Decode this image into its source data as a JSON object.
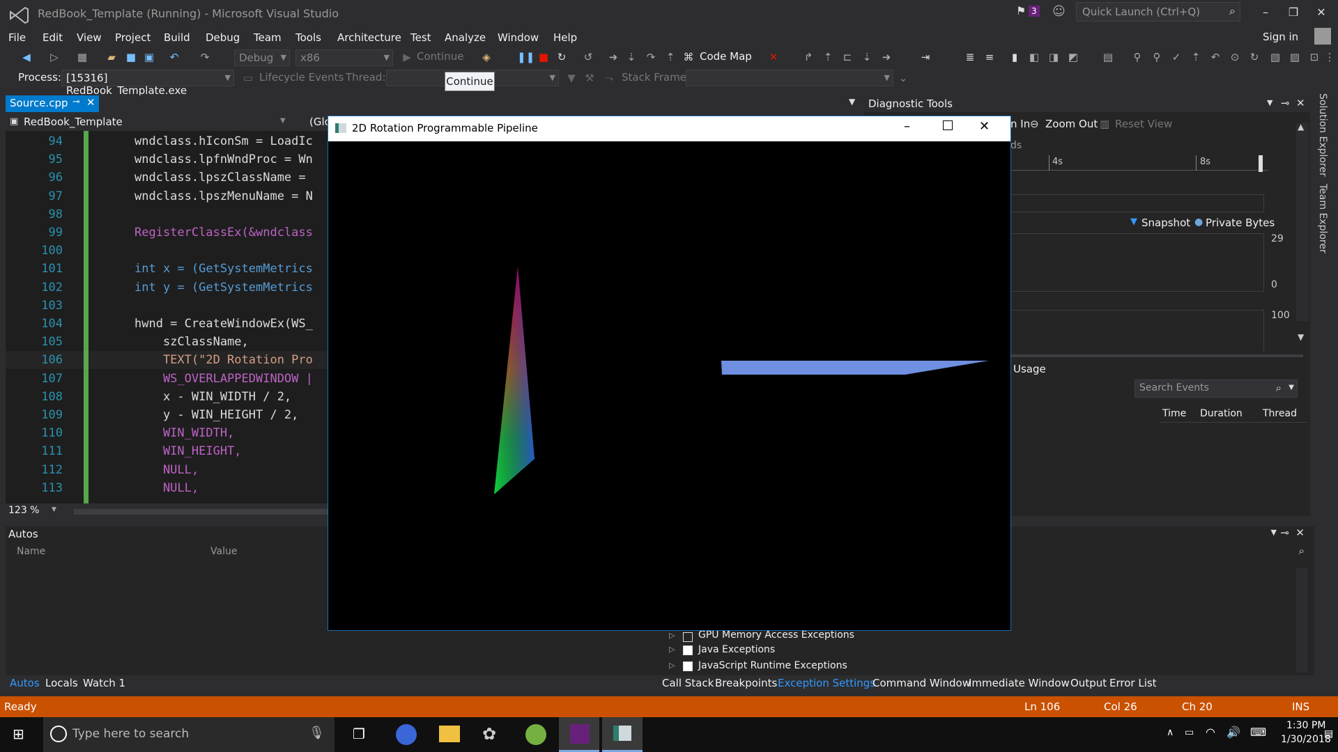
{
  "titlebar": {
    "app_title": "RedBook_Template (Running) - Microsoft Visual Studio",
    "notif_count": "3",
    "quick_launch": "Quick Launch (Ctrl+Q)"
  },
  "menu": [
    "File",
    "Edit",
    "View",
    "Project",
    "Build",
    "Debug",
    "Team",
    "Tools",
    "Architecture",
    "Test",
    "Analyze",
    "Window",
    "Help"
  ],
  "sign_in": "Sign in",
  "toolbar": {
    "config": "Debug",
    "platform": "x86",
    "continue": "Continue",
    "code_map": "Code Map"
  },
  "toolbar2": {
    "process_label": "Process:",
    "process_value": "[15316] RedBook_Template.exe",
    "lifecycle": "Lifecycle Events",
    "thread_label": "Thread:",
    "stack_label": "Stack Frame:"
  },
  "tooltip": "Continue",
  "editor": {
    "tab": "Source.cpp",
    "project": "RedBook_Template",
    "scope": "(Glo",
    "zoom": "123 %",
    "lines": [
      {
        "n": "94",
        "t": "wndclass.hIconSm = LoadIc"
      },
      {
        "n": "95",
        "t": "wndclass.lpfnWndProc = Wn"
      },
      {
        "n": "96",
        "t": "wndclass.lpszClassName = "
      },
      {
        "n": "97",
        "t": "wndclass.lpszMenuName = N"
      },
      {
        "n": "98",
        "t": ""
      },
      {
        "n": "99",
        "t": "RegisterClassEx(&wndclass"
      },
      {
        "n": "100",
        "t": ""
      },
      {
        "n": "101",
        "t": "int x = (GetSystemMetrics"
      },
      {
        "n": "102",
        "t": "int y = (GetSystemMetrics"
      },
      {
        "n": "103",
        "t": ""
      },
      {
        "n": "104",
        "t": "hwnd = CreateWindowEx(WS_"
      },
      {
        "n": "105",
        "t": "    szClassName,"
      },
      {
        "n": "106",
        "t": "    TEXT(\"2D Rotation Pro"
      },
      {
        "n": "107",
        "t": "    WS_OVERLAPPEDWINDOW |"
      },
      {
        "n": "108",
        "t": "    x - WIN_WIDTH / 2,"
      },
      {
        "n": "109",
        "t": "    y - WIN_HEIGHT / 2,"
      },
      {
        "n": "110",
        "t": "    WIN_WIDTH,"
      },
      {
        "n": "111",
        "t": "    WIN_HEIGHT,"
      },
      {
        "n": "112",
        "t": "    NULL,"
      },
      {
        "n": "113",
        "t": "    NULL,"
      }
    ]
  },
  "autos": {
    "title": "Autos",
    "col_name": "Name",
    "col_value": "Value",
    "tabs": [
      "Autos",
      "Locals",
      "Watch 1"
    ]
  },
  "diag": {
    "title": "Diagnostic Tools",
    "zoom_in": "n In",
    "zoom_out": "Zoom Out",
    "reset_view": "Reset View",
    "axis_4s": "4s",
    "axis_8s": "8s",
    "snapshot": "Snapshot",
    "private_bytes": "Private Bytes",
    "v29": "29",
    "v0": "0",
    "v100": "100",
    "usage": "Usage",
    "search": "Search Events",
    "col_time": "Time",
    "col_duration": "Duration",
    "col_thread": "Thread",
    "ds": "ds"
  },
  "rail": [
    "Solution Explorer",
    "Team Explorer"
  ],
  "exceptions": {
    "items": [
      "GPU Memory Access Exceptions",
      "Java Exceptions",
      "JavaScript Runtime Exceptions"
    ],
    "tabs": [
      "Call Stack",
      "Breakpoints",
      "Exception Settings",
      "Command Window",
      "Immediate Window",
      "Output",
      "Error List"
    ]
  },
  "status": {
    "ready": "Ready",
    "ln": "Ln 106",
    "col": "Col 26",
    "ch": "Ch 20",
    "ins": "INS"
  },
  "taskbar": {
    "search": "Type here to search",
    "time": "1:30 PM",
    "date": "1/30/2018"
  },
  "appwin": {
    "title": "2D Rotation Programmable Pipeline"
  },
  "colors": {
    "accent": "#007acc",
    "status": "#ca5100",
    "vs_purple": "#68217a",
    "green_bar": "#57a64a",
    "quad": "#6f8fe0"
  }
}
